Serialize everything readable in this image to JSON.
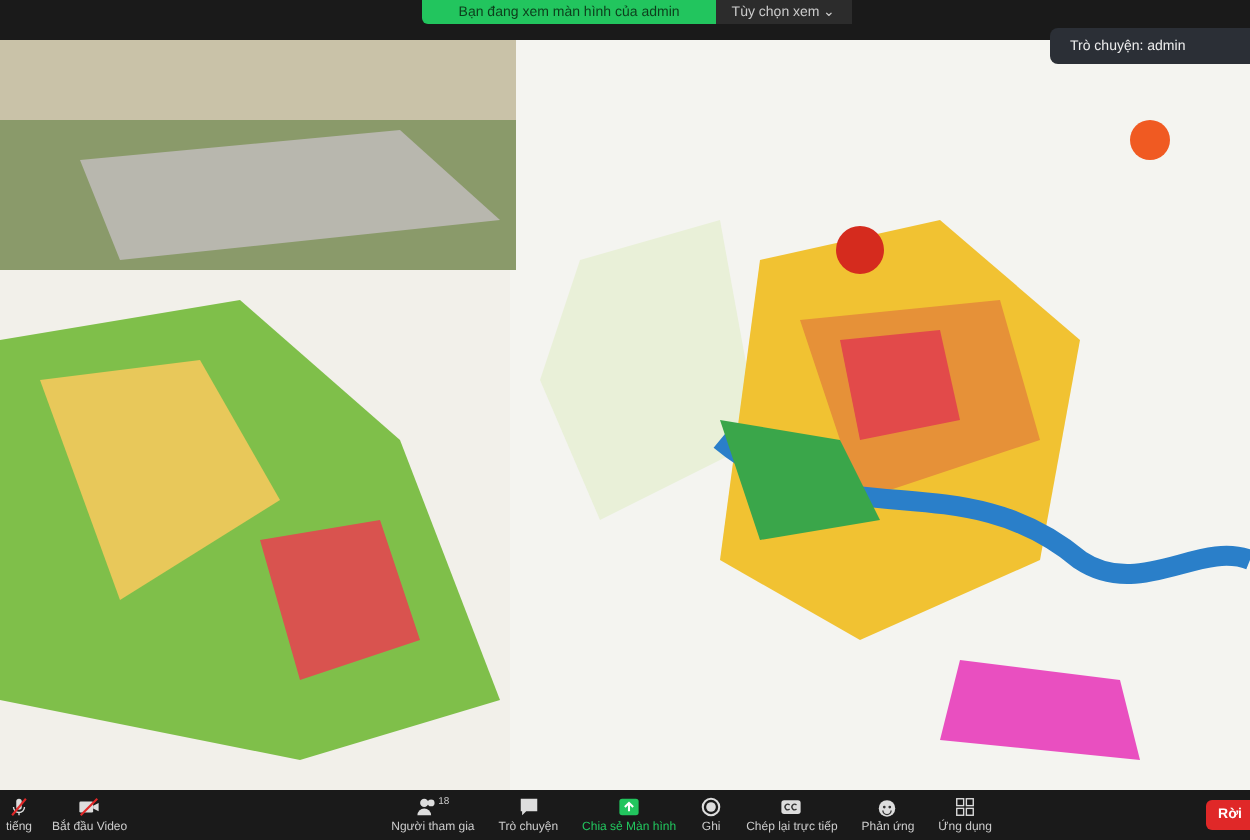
{
  "share_banner": {
    "text": "Bạn đang xem màn hình của admin",
    "view_options": "Tùy chọn xem ⌄"
  },
  "chat_popup": {
    "title": "Trò chuyện: admin"
  },
  "toolbar": {
    "left": [
      {
        "kind": "mic",
        "label": "tiếng",
        "muted": true
      },
      {
        "kind": "video",
        "label": "Bắt đầu Video",
        "muted": true
      }
    ],
    "center": [
      {
        "kind": "participants",
        "label": "Người tham gia",
        "count": "18",
        "active": false
      },
      {
        "kind": "chat",
        "label": "Trò chuyện",
        "active": false
      },
      {
        "kind": "share",
        "label": "Chia sẻ Màn hình",
        "active": true
      },
      {
        "kind": "record",
        "label": "Ghi",
        "active": false
      },
      {
        "kind": "cc",
        "label": "Chép lại trực tiếp",
        "active": false
      },
      {
        "kind": "react",
        "label": "Phản ứng",
        "active": false
      },
      {
        "kind": "apps",
        "label": "Ứng dụng",
        "active": false
      }
    ],
    "leave": "Rời"
  }
}
